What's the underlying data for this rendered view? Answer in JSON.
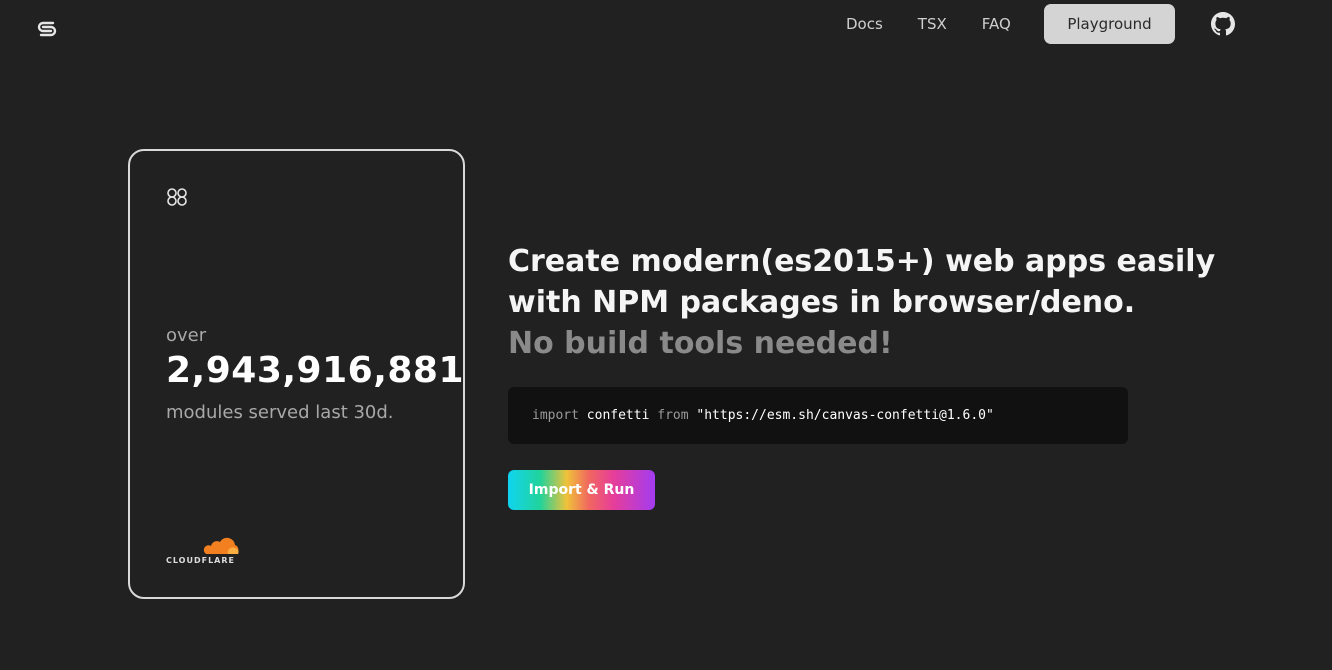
{
  "header": {
    "logo_icon": "esm-logo-icon",
    "nav": [
      {
        "label": "Docs"
      },
      {
        "label": "TSX"
      },
      {
        "label": "FAQ"
      }
    ],
    "playground_label": "Playground",
    "github_icon": "github-icon"
  },
  "stats": {
    "icon": "infinity-icon",
    "over_label": "over",
    "count": "2,943,916,881",
    "caption": "modules served last 30d.",
    "sponsor": "CLOUDFLARE",
    "sponsor_color": "#f38020"
  },
  "hero": {
    "line1": "Create modern(es2015+) web apps easily",
    "line2": "with NPM packages in browser/deno.",
    "line3": "No build tools needed!"
  },
  "code": {
    "keyword_import": "import",
    "identifier": "confetti",
    "keyword_from": "from",
    "url": "\"https://esm.sh/canvas-confetti@1.6.0\""
  },
  "run_button": {
    "label": "Import & Run"
  }
}
